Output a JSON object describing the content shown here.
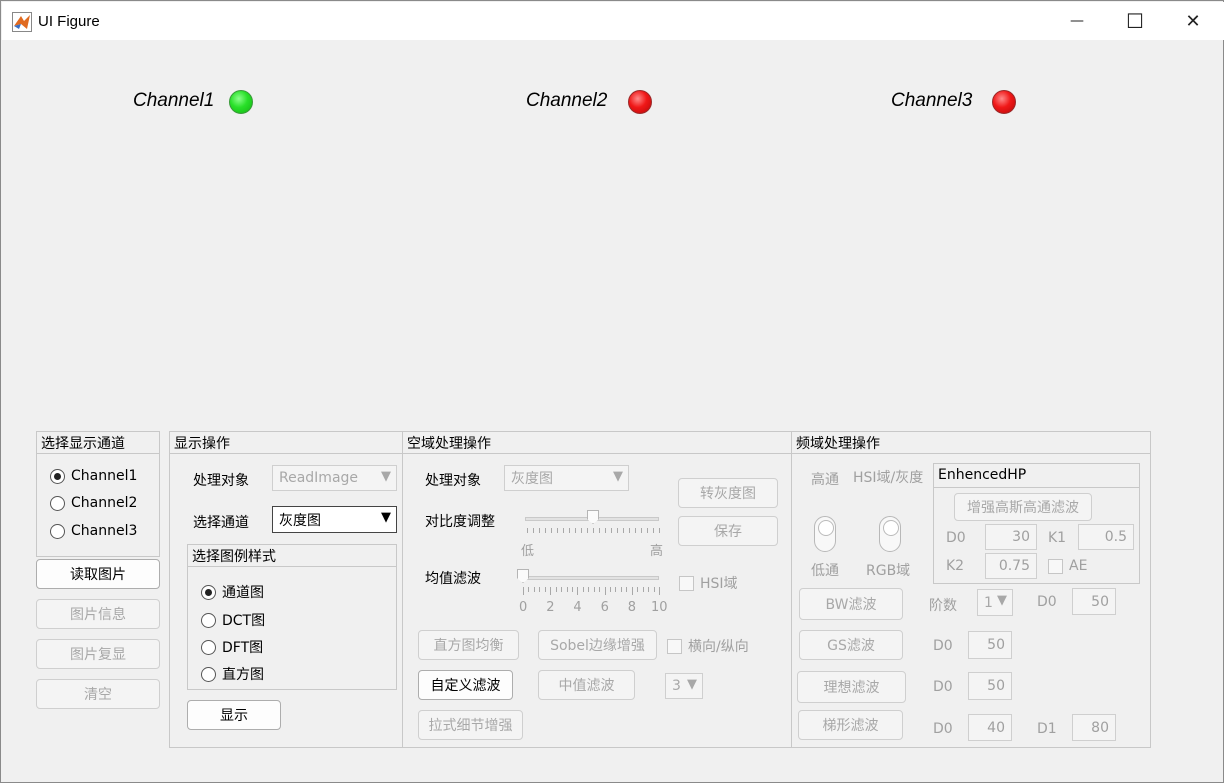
{
  "window": {
    "title": "UI Figure",
    "minimize": "—",
    "maximize": "☐",
    "close": "✕"
  },
  "lamps": [
    {
      "label": "Channel1",
      "color": "green"
    },
    {
      "label": "Channel2",
      "color": "red"
    },
    {
      "label": "Channel3",
      "color": "red"
    }
  ],
  "channel_panel": {
    "title": "选择显示通道",
    "options": [
      "Channel1",
      "Channel2",
      "Channel3"
    ],
    "selected": "Channel1",
    "buttons": {
      "read": "读取图片",
      "info": "图片信息",
      "restore": "图片复显",
      "clear": "清空"
    }
  },
  "display_panel": {
    "title": "显示操作",
    "target_label": "处理对象",
    "target_value": "ReadImage",
    "channel_label": "选择通道",
    "channel_value": "灰度图",
    "legend_group": {
      "title": "选择图例样式",
      "options": [
        "通道图",
        "DCT图",
        "DFT图",
        "直方图"
      ],
      "selected": "通道图"
    },
    "show_button": "显示"
  },
  "spatial_panel": {
    "title": "空域处理操作",
    "target_label": "处理对象",
    "target_value": "灰度图",
    "gray_button": "转灰度图",
    "contrast_label": "对比度调整",
    "contrast_low": "低",
    "contrast_high": "高",
    "contrast_level": 0.5,
    "save_button": "保存",
    "mean_label": "均值滤波",
    "mean_ticks": [
      "0",
      "2",
      "4",
      "6",
      "8",
      "10"
    ],
    "mean_value": 0,
    "hsi_checkbox": "HSI域",
    "hist_eq_button": "直方图均衡",
    "sobel_button": "Sobel边缘增强",
    "hv_checkbox": "横向/纵向",
    "custom_filter_button": "自定义滤波",
    "median_button": "中值滤波",
    "median_size": "3",
    "laplace_button": "拉式细节增强"
  },
  "freq_panel": {
    "title": "频域处理操作",
    "high_label": "高通",
    "low_label": "低通",
    "domain_label": "HSI域/灰度",
    "rgb_label": "RGB域",
    "enhanced": {
      "title": "EnhencedHP",
      "button": "增强高斯高通滤波",
      "d0_label": "D0",
      "d0_value": "30",
      "k1_label": "K1",
      "k1_value": "0.5",
      "k2_label": "K2",
      "k2_value": "0.75",
      "ae_label": "AE"
    },
    "bw_button": "BW滤波",
    "order_label": "阶数",
    "order_value": "1",
    "bw_d0_label": "D0",
    "bw_d0_value": "50",
    "gs_button": "GS滤波",
    "gs_d0_label": "D0",
    "gs_d0_value": "50",
    "ideal_button": "理想滤波",
    "ideal_d0_label": "D0",
    "ideal_d0_value": "50",
    "trap_button": "梯形滤波",
    "trap_d0_label": "D0",
    "trap_d0_value": "40",
    "trap_d1_label": "D1",
    "trap_d1_value": "80"
  }
}
